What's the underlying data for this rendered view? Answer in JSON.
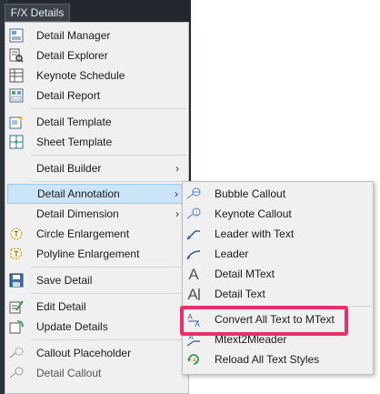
{
  "menubar": {
    "tab_label": "F/X Details"
  },
  "menu": {
    "items": [
      {
        "label": "Detail Manager",
        "icon": "detail-manager-icon"
      },
      {
        "label": "Detail Explorer",
        "icon": "detail-explorer-icon"
      },
      {
        "label": "Keynote Schedule",
        "icon": "keynote-schedule-icon"
      },
      {
        "label": "Detail Report",
        "icon": "detail-report-icon"
      },
      {
        "label": "Detail Template",
        "icon": "detail-template-icon"
      },
      {
        "label": "Sheet Template",
        "icon": "sheet-template-icon"
      },
      {
        "label": "Detail Builder",
        "has_submenu": true
      },
      {
        "label": "Detail Annotation",
        "has_submenu": true,
        "selected": true
      },
      {
        "label": "Detail Dimension",
        "has_submenu": true
      },
      {
        "label": "Circle Enlargement",
        "icon": "circle-enlargement-icon"
      },
      {
        "label": "Polyline Enlargement",
        "icon": "polyline-enlargement-icon"
      },
      {
        "label": "Save Detail",
        "icon": "save-detail-icon"
      },
      {
        "label": "Edit Detail",
        "icon": "edit-detail-icon"
      },
      {
        "label": "Update Details",
        "icon": "update-details-icon"
      },
      {
        "label": "Callout Placeholder",
        "icon": "callout-placeholder-icon"
      },
      {
        "label": "Detail Callout",
        "icon": "detail-callout-icon"
      }
    ],
    "submenu_arrow": "›"
  },
  "submenu": {
    "items": [
      {
        "label": "Bubble Callout",
        "icon": "bubble-callout-icon"
      },
      {
        "label": "Keynote Callout",
        "icon": "keynote-callout-icon"
      },
      {
        "label": "Leader with Text",
        "icon": "leader-with-text-icon"
      },
      {
        "label": "Leader",
        "icon": "leader-icon"
      },
      {
        "label": "Detail MText",
        "icon": "detail-mtext-icon"
      },
      {
        "label": "Detail Text",
        "icon": "detail-text-icon"
      },
      {
        "label": "Convert All Text to MText",
        "icon": "convert-text-icon",
        "highlighted": true
      },
      {
        "label": "Mtext2Mleader",
        "icon": "mtext2mleader-icon"
      },
      {
        "label": "Reload All Text Styles",
        "icon": "reload-text-styles-icon"
      }
    ]
  },
  "colors": {
    "highlight_border": "#e8306a",
    "selected_bg": "#cce4f7",
    "menu_bg": "#f0f0f0"
  }
}
